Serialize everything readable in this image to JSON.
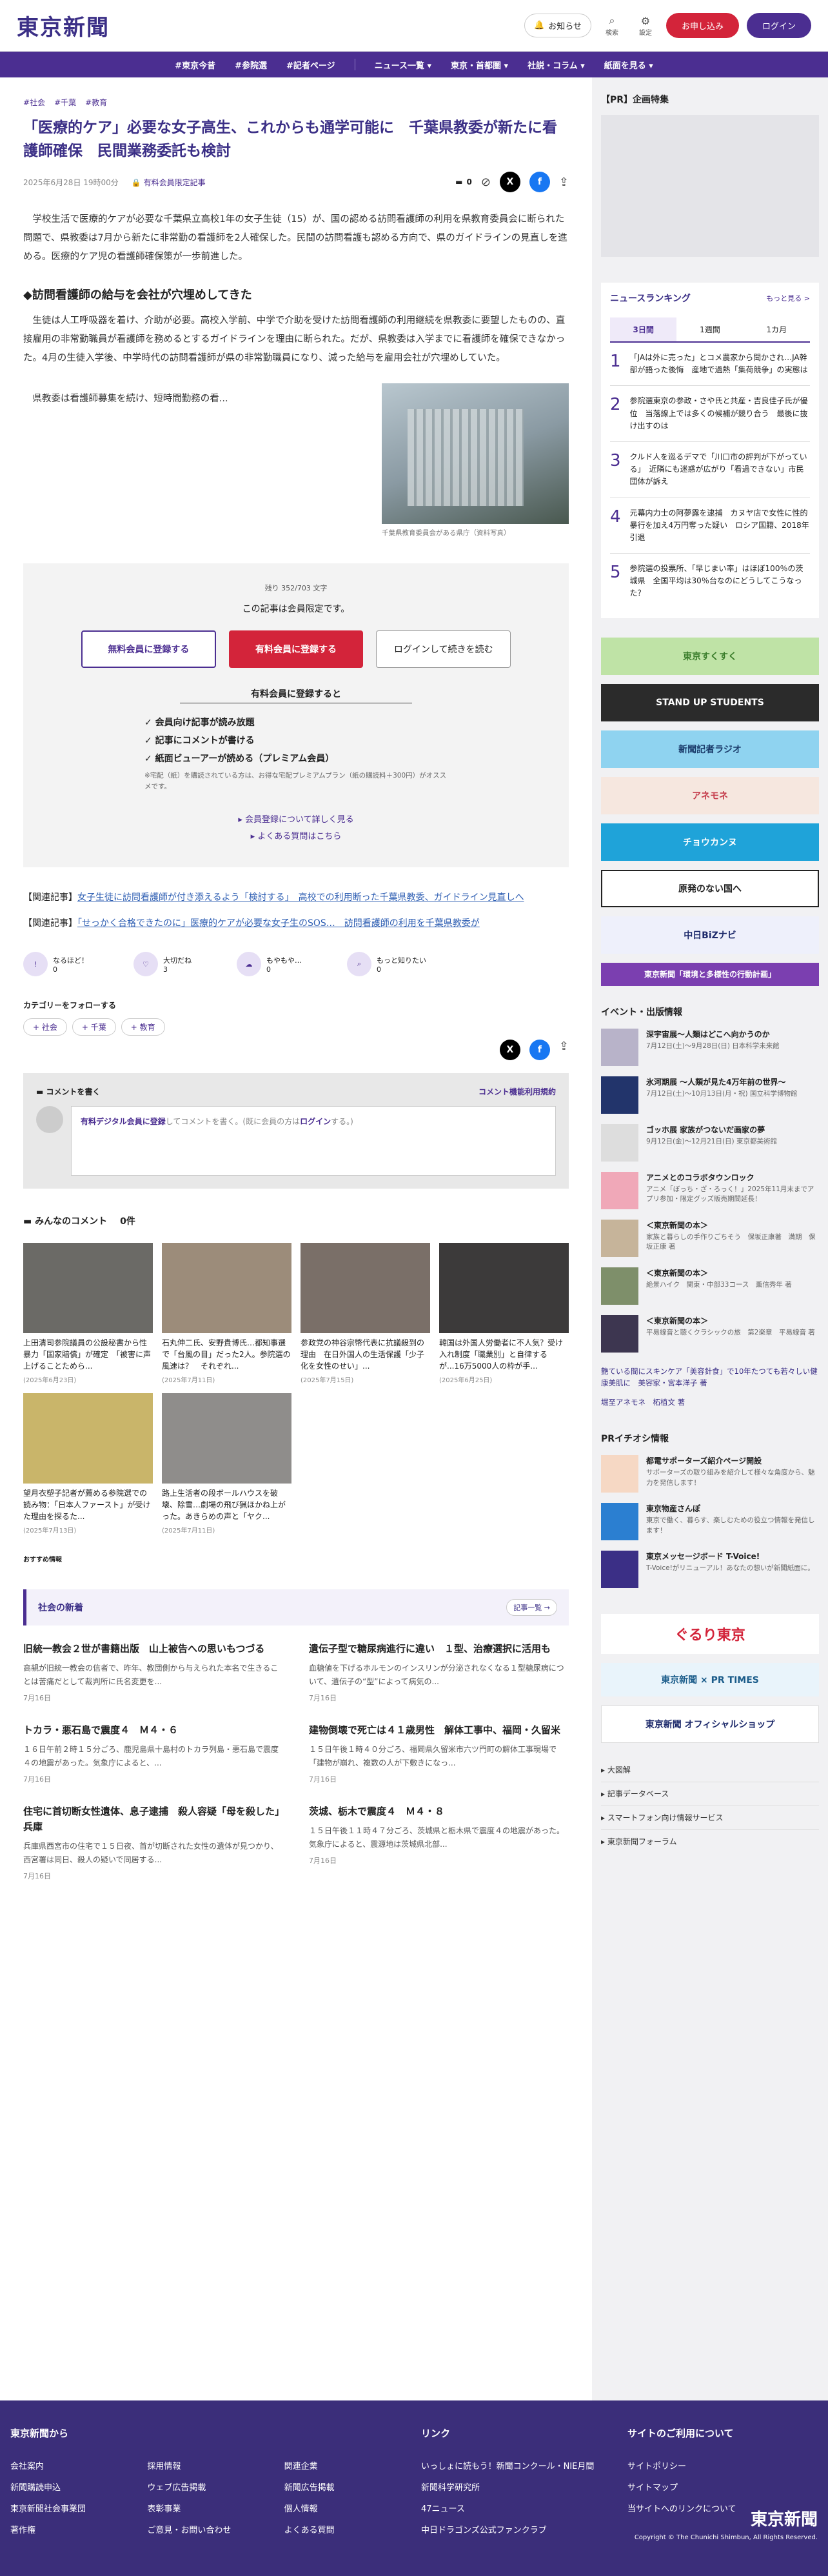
{
  "header": {
    "logo": "東京新聞",
    "notice": "お知らせ",
    "search": "検索",
    "settings": "設定",
    "register": "お申し込み",
    "login": "ログイン"
  },
  "nav": [
    "#東京今昔",
    "#参院選",
    "#記者ページ",
    "ニュース一覧 ▾",
    "東京・首都圏 ▾",
    "社説・コラム ▾",
    "紙面を見る ▾"
  ],
  "article": {
    "tags": [
      "#社会",
      "#千葉",
      "#教育"
    ],
    "title": "「医療的ケア」必要な女子高生、これからも通学可能に　千葉県教委が新たに看護師確保　民間業務委託も検討",
    "date": "2025年6月28日 19時00分",
    "member_label": "有料会員限定記事",
    "comment_count": "0",
    "p1": "学校生活で医療的ケアが必要な千葉県立高校1年の女子生徒（15）が、国の認める訪問看護師の利用を県教育委員会に断られた問題で、県教委は7月から新たに非常勤の看護師を2人確保した。民間の訪問看護も認める方向で、県のガイドラインの見直しを進める。医療的ケア児の看護師確保策が一歩前進した。",
    "h2": "◆訪問看護師の給与を会社が穴埋めしてきた",
    "p2": "生徒は人工呼吸器を着け、介助が必要。高校入学前、中学で介助を受けた訪問看護師の利用継続を県教委に要望したものの、直接雇用の非常勤職員が看護師を務めるとするガイドラインを理由に断られた。だが、県教委は入学までに看護師を確保できなかった。4月の生徒入学後、中学時代の訪問看護師が県の非常勤職員になり、減った給与を雇用会社が穴埋めしていた。",
    "p3": "県教委は看護師募集を続け、短時間勤務の看...",
    "caption": "千葉県教育委員会がある県庁（資料写真）"
  },
  "paywall": {
    "remaining": "残り 352/703 文字",
    "notice": "この記事は会員限定です。",
    "free_btn": "無料会員に登録する",
    "paid_btn": "有料会員に登録する",
    "login_btn": "ログインして続きを読む",
    "benefits_title": "有料会員に登録すると",
    "benefits": [
      "会員向け記事が読み放題",
      "記事にコメントが書ける",
      "紙面ビューアーが読める（プレミアム会員）"
    ],
    "note": "※宅配（紙）を購読されている方は、お得な宅配プレミアムプラン（紙の購読料＋300円）がオススメです。",
    "link1": "会員登録について詳しく見る",
    "link2": "よくある質問はこちら"
  },
  "related": [
    {
      "prefix": "【関連記事】",
      "text": "女子生徒に訪問看護師が付き添えるよう「検討する」　高校での利用断った千葉県教委、ガイドライン見直しへ"
    },
    {
      "prefix": "【関連記事】",
      "text": "「せっかく合格できたのに」医療的ケアが必要な女子生のSOS…　訪問看護師の利用を千葉県教委が"
    }
  ],
  "reactions": [
    {
      "label": "なるほど！",
      "count": "0"
    },
    {
      "label": "大切だね",
      "count": "3"
    },
    {
      "label": "もやもや…",
      "count": "0"
    },
    {
      "label": "もっと知りたい",
      "count": "0"
    }
  ],
  "follow": {
    "title": "カテゴリーをフォローする",
    "chips": [
      "+ 社会",
      "+ 千葉",
      "+ 教育"
    ]
  },
  "comment": {
    "title": "コメントを書く",
    "rules": "コメント機能利用規約",
    "placeholder_a": "有料デジタル会員に登録",
    "placeholder_b": "してコメントを書く。(既に会員の方は",
    "placeholder_c": "ログイン",
    "placeholder_d": "する。)"
  },
  "comments_section": {
    "title": "みんなのコメント",
    "count": "0件"
  },
  "cards": [
    {
      "t": "上田清司参院議員の公設秘書から性暴力「国家賠償」が確定　「被害に声上げることためら...",
      "d": "(2025年6月23日)",
      "c": "#6b6a66"
    },
    {
      "t": "石丸伸二氏、安野貴博氏…都知事選で「台風の目」だった2人。参院選の風速は？　それぞれ...",
      "d": "(2025年7月11日)",
      "c": "#9c8c7a"
    },
    {
      "t": "参政党の神谷宗幣代表に抗議殺到の理由　在日外国人の生活保護「少子化を女性のせい」...",
      "d": "(2025年7月15日)",
      "c": "#7a6f68"
    },
    {
      "t": "韓国は外国人労働者に不人気？受け入れ制度「職業別」と自律するが...16万5000人の枠が手...",
      "d": "(2025年6月25日)",
      "c": "#3c3a3a"
    },
    {
      "t": "望月衣塑子記者が薦める参院選での読み物：「日本人ファースト」が受けた理由を探るた...",
      "d": "(2025年7月13日)",
      "c": "#c9b56a"
    },
    {
      "t": "路上生活者の段ボールハウスを破壊、除雪…劇場の飛び猟ほかね上がった。あきらめの声と「ヤク...",
      "d": "(2025年7月11日)",
      "c": "#8f8d8b"
    }
  ],
  "osusume": "おすすめ情報",
  "shakai": {
    "title": "社会の新着",
    "more": "記事一覧 →",
    "items": [
      {
        "t": "旧統一教会２世が書籍出版　山上被告への思いもつづる",
        "d": "高親が旧統一教会の信者で、昨年、教団側から与えられた本名で生きることは苦痛だとして裁判所に氏名変更を...",
        "date": "7月16日"
      },
      {
        "t": "遺伝子型で糖尿病進行に違い　１型、治療選択に活用も",
        "d": "血糖値を下げるホルモンのインスリンが分泌されなくなる１型糖尿病について、遺伝子の“型”によって病気の...",
        "date": "7月16日"
      },
      {
        "t": "トカラ・悪石島で震度４　Ｍ４・６",
        "d": "１６日午前２時１５分ごろ、鹿児島県十島村のトカラ列島・悪石島で震度４の地震があった。気象庁によると、...",
        "date": "7月16日"
      },
      {
        "t": "建物倒壊で死亡は４１歳男性　解体工事中、福岡・久留米",
        "d": "１５日午後１時４０分ごろ、福岡県久留米市六ツ門町の解体工事現場で「建物が崩れ、複数の人が下敷きになっ...",
        "date": "7月16日"
      },
      {
        "t": "住宅に首切断女性遺体、息子逮捕　殺人容疑「母を殺した」兵庫",
        "d": "兵庫県西宮市の住宅で１５日夜、首が切断された女性の遺体が見つかり、西宮署は同日、殺人の疑いで同居する...",
        "date": "7月16日"
      },
      {
        "t": "茨城、栃木で震度４　Ｍ４・８",
        "d": "１５日午後１１時４７分ごろ、茨城県と栃木県で震度４の地震があった。気象庁によると、震源地は茨城県北部...",
        "date": "7月16日"
      }
    ]
  },
  "side": {
    "pr": "【PR】企画特集",
    "ranking_title": "ニュースランキング",
    "ranking_more": "もっと見る >",
    "tabs": [
      "3日間",
      "1週間",
      "1カ月"
    ],
    "ranks": [
      "「JAは外に売った」とコメ農家から聞かされ…JA幹部が語った後悔　産地で過熱「集荷競争」の実態は",
      "参院選東京の参政・さや氏と共産・吉良佳子氏が優位　当落線上では多くの候補が競り合う　最後に抜け出すのは",
      "クルド人を巡るデマで「川口市の評判が下がっている」　近隣にも迷惑が広がり「看過できない」市民団体が訴え",
      "元幕内力士の阿夢露を逮捕　カヌヤ店で女性に性的暴行を加え4万円奪った疑い　ロシア国籍、2018年引退",
      "参院選の投票所、「早じまい率」はほぼ100％の茨城県　全国平均は30％台なのにどうしてこうなった？"
    ],
    "banners": [
      {
        "t": "東京すくすく",
        "bg": "#bfe3a6",
        "fg": "#3a7d2b"
      },
      {
        "t": "STAND UP STUDENTS",
        "bg": "#2b2b2b",
        "fg": "#fff"
      },
      {
        "t": "新聞記者ラジオ",
        "bg": "#8fd3f0",
        "fg": "#1b3c6b"
      },
      {
        "t": "アネモネ",
        "bg": "#f6e7df",
        "fg": "#c43b4a"
      },
      {
        "t": "チョウカンヌ",
        "bg": "#1fa3d9",
        "fg": "#fff"
      },
      {
        "t": "原発のない国へ",
        "bg": "#fff",
        "fg": "#222"
      },
      {
        "t": "中日BiZナビ",
        "bg": "#eef0fb",
        "fg": "#1d2a6b"
      },
      {
        "t": "東京新聞「環境と多様性の行動計画」",
        "bg": "#7b3fb0",
        "fg": "#fff"
      }
    ],
    "events_title": "イベント・出版情報",
    "events": [
      {
        "t": "深宇宙展〜人類はどこへ向かうのか",
        "d": "7月12日(土)〜9月28日(日) 日本科学未来館"
      },
      {
        "t": "氷河期展 〜人類が見た4万年前の世界〜",
        "d": "7月12日(土)〜10月13日(月・祝) 国立科学博物館"
      },
      {
        "t": "ゴッホ展 家族がつないだ画家の夢",
        "d": "9月12日(金)〜12月21日(日) 東京都美術館"
      },
      {
        "t": "アニメとのコラボタウンロック",
        "d": "アニメ「ぼっち・ざ・ろっく！」2025年11月末までアプリ参加・限定グッズ販売期間延長！"
      },
      {
        "t": "＜東京新聞の本＞",
        "d": "家族と暮らしの手作りごちそう　保坂正康著　満期　保坂正康 著"
      },
      {
        "t": "＜東京新聞の本＞",
        "d": "絶景ハイク　関東・中部33コース　薫信秀年 著"
      },
      {
        "t": "＜東京新聞の本＞",
        "d": "平易線音と聴くクラシックの旅　第2楽章　平易線音 著"
      }
    ],
    "ad_links": [
      "艶ている間にスキンケア「美容針食」で10年たつても若々しい健康美肌に　美容家・宮本洋子 著",
      "堀至アネモネ　柘植文 著"
    ],
    "prchiban_title": "PRイチオシ情報",
    "prchiban": [
      {
        "t": "都電サポーターズ紹介ページ開設",
        "d": "サポーターズの取り組みを紹介して様々な角度から、魅力を発信します！"
      },
      {
        "t": "東京物産さんぽ",
        "d": "東京で働く、暮らす、楽しむための役立つ情報を発信します！"
      },
      {
        "t": "東京メッセージボード T-Voice!",
        "d": "T-Voice!がリニューアル！あなたの想いが新聞紙面に。"
      }
    ],
    "bottom_banners": [
      "ぐるり東京",
      "東京新聞 × PR TIMES",
      "東京新聞 オフィシャルショップ"
    ],
    "links": [
      "大図解",
      "記事データベース",
      "スマートフォン向け情報サービス",
      "東京新聞フォーラム"
    ]
  },
  "footer": {
    "col1_title": "東京新聞から",
    "col1": [
      "会社案内",
      "採用情報",
      "関連企業",
      "新聞購読申込",
      "ウェブ広告掲載",
      "新聞広告掲載",
      "東京新聞社会事業団",
      "表彰事業",
      "個人情報",
      "著作権",
      "ご意見・お問い合わせ",
      "よくある質問"
    ],
    "col2_title": "リンク",
    "col2": [
      "いっしょに読もう！新聞コンクール・NIE月間",
      "新聞科学研究所",
      "47ニュース",
      "中日ドラゴンズ公式ファンクラブ"
    ],
    "col3_title": "サイトのご利用について",
    "col3": [
      "サイトポリシー",
      "サイトマップ",
      "当サイトへのリンクについて"
    ],
    "logo": "東京新聞",
    "copyright": "Copyright © The Chunichi Shimbun, All Rights Reserved."
  }
}
